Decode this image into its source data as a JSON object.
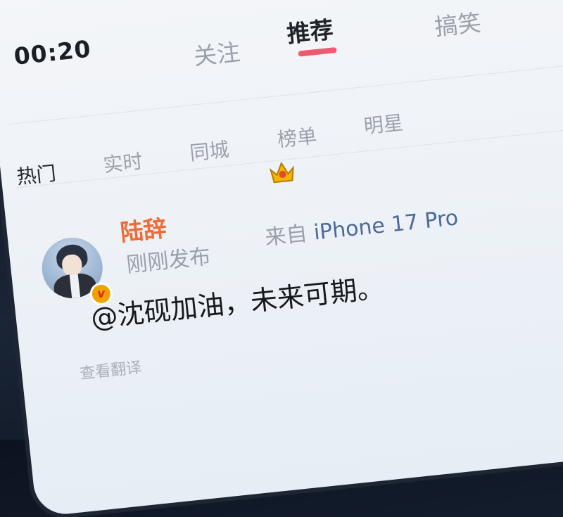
{
  "status_bar": {
    "time": "00:20"
  },
  "main_tabs": [
    {
      "label": "关注",
      "active": false
    },
    {
      "label": "推荐",
      "active": true
    },
    {
      "label": "搞笑",
      "active": false
    }
  ],
  "sub_tabs": [
    {
      "label": "热门",
      "active": true
    },
    {
      "label": "实时",
      "active": false
    },
    {
      "label": "同城",
      "active": false
    },
    {
      "label": "榜单",
      "active": false
    },
    {
      "label": "明星",
      "active": false
    }
  ],
  "post": {
    "username": "陆辞",
    "time": "刚刚发布",
    "source_prefix": "来自",
    "source_device": "iPhone 17 Pro",
    "body": "@沈砚加油，未来可期。",
    "translate_label": "查看翻译",
    "verified_badge": "v"
  },
  "colors": {
    "accent_indicator": "#ef5a72",
    "username": "#f06a35",
    "device_link": "#4a6a9a",
    "verified_badge": "#f0a300"
  },
  "icons": [
    "menu-icon",
    "vip-crown-icon",
    "verified-icon",
    "avatar"
  ]
}
